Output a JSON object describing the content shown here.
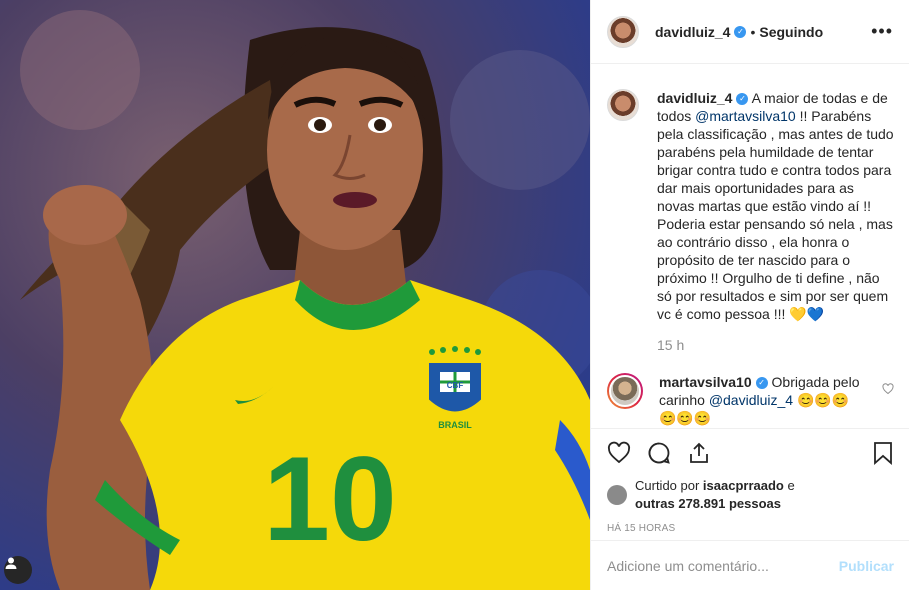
{
  "post": {
    "author": "davidluiz_4",
    "follow_status": "Seguindo",
    "separator": "•",
    "more_icon": "ellipsis-icon",
    "verified_mark": "✓"
  },
  "caption": {
    "username": "davidluiz_4",
    "text_part1": " A maior de todas e de todos ",
    "mention": "@martavsilva10",
    "text_part2": " !! Parabéns pela classificação , mas antes de tudo parabéns pela humildade de tentar brigar contra tudo e contra todos para dar mais oportunidades para as novas martas que estão vindo aí !! Poderia estar pensando só nela , mas ao contrário disso , ela honra o propósito de ter nascido para o próximo !! Orgulho de ti define , não só por resultados e sim por ser quem vc é como pessoa !!! 💛💙",
    "time": "15 h"
  },
  "reply": {
    "username": "martavsilva10",
    "text_part1": " Obrigada pelo carinho ",
    "mention": "@davidluiz_4",
    "text_part2": " 😊😊😊 😊😊😊"
  },
  "likes": {
    "prefix": "Curtido por ",
    "user": "isaacprraado",
    "middle": " e",
    "others": "outras 278.891 pessoas"
  },
  "time_ago": "HÁ 15 HORAS",
  "comment_box": {
    "placeholder": "Adicione um comentário...",
    "publish_label": "Publicar"
  },
  "photo": {
    "jersey_number": "10",
    "crest_text": "CBF",
    "crest_label": "BRASIL",
    "colors": {
      "jersey": "#f5d90a",
      "trim": "#1f9a3a",
      "number": "#1f8f3e"
    }
  }
}
